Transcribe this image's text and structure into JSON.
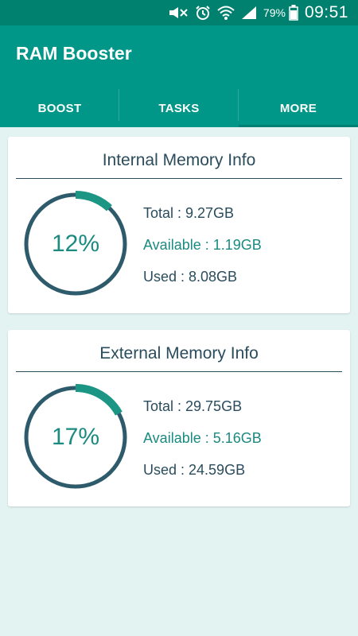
{
  "status_bar": {
    "battery_percent": "79%",
    "time": "09:51",
    "icons": [
      "mute-icon",
      "alarm-icon",
      "wifi-icon",
      "signal-icon",
      "battery-icon"
    ]
  },
  "app": {
    "title": "RAM Booster"
  },
  "tabs": [
    {
      "label": "BOOST",
      "active": false
    },
    {
      "label": "TASKS",
      "active": false
    },
    {
      "label": "MORE",
      "active": true
    }
  ],
  "colors": {
    "primary": "#009688",
    "status_bar": "#00806e",
    "ring_track": "#2e5b6b",
    "ring_fill": "#1b9584",
    "text_dark": "#2a4c5c",
    "text_accent": "#1b8a80",
    "background": "#e3f3f2"
  },
  "internal": {
    "title": "Internal Memory Info",
    "percent": "12%",
    "fraction": 0.12,
    "total": "Total : 9.27GB",
    "available": "Available : 1.19GB",
    "used": "Used : 8.08GB"
  },
  "external": {
    "title": "External Memory Info",
    "percent": "17%",
    "fraction": 0.17,
    "total": "Total : 29.75GB",
    "available": "Available : 5.16GB",
    "used": "Used : 24.59GB"
  }
}
